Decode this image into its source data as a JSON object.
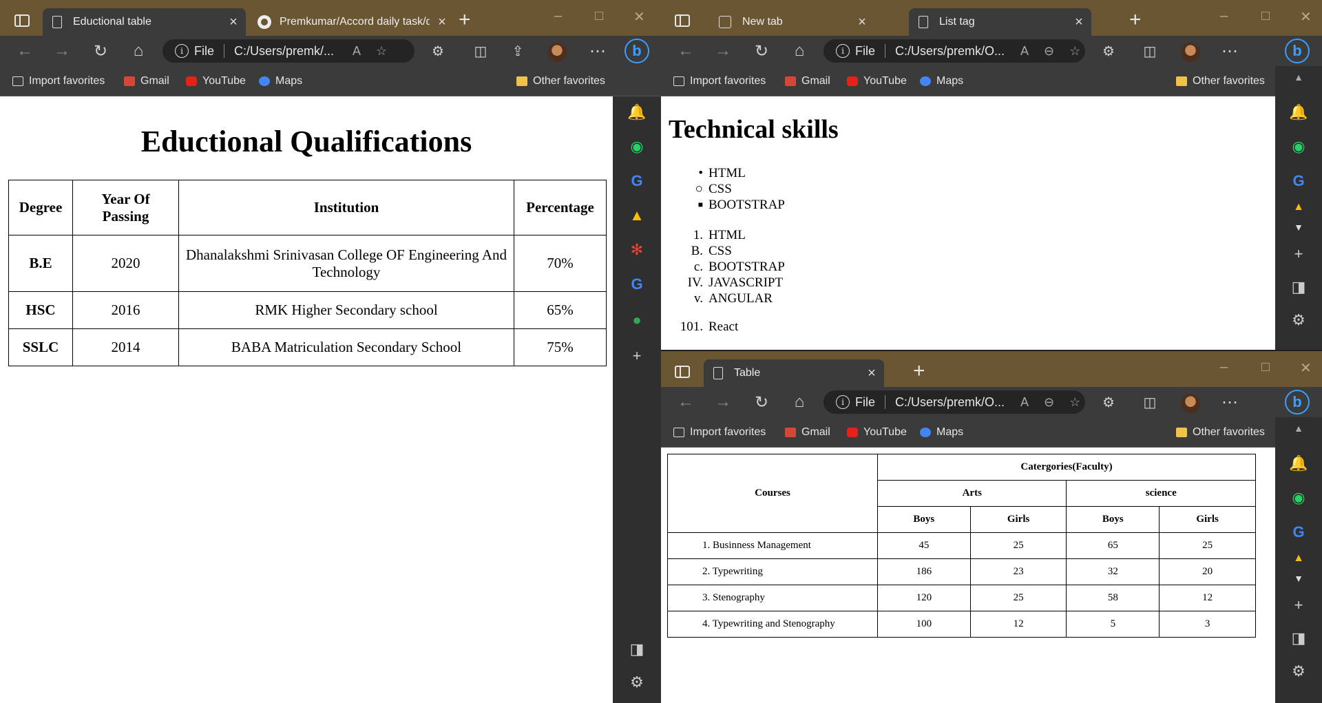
{
  "left_window": {
    "tabs": [
      {
        "label": "Eductional table",
        "active": true
      },
      {
        "label": "Premkumar/Accord daily task/da",
        "active": false
      }
    ],
    "address": {
      "scheme": "File",
      "url": "C:/Users/premk/..."
    },
    "page": {
      "heading": "Eductional Qualifications",
      "columns": [
        "Degree",
        "Year Of Passing",
        "Institution",
        "Percentage"
      ],
      "rows": [
        {
          "degree": "B.E",
          "year": "2020",
          "institution": "Dhanalakshmi Srinivasan College OF Engineering And Technology",
          "percentage": "70%"
        },
        {
          "degree": "HSC",
          "year": "2016",
          "institution": "RMK Higher Secondary school",
          "percentage": "65%"
        },
        {
          "degree": "SSLC",
          "year": "2014",
          "institution": "BABA Matriculation Secondary School",
          "percentage": "75%"
        }
      ]
    }
  },
  "top_right_window": {
    "tabs": [
      {
        "label": "New tab",
        "active": false
      },
      {
        "label": "List tag",
        "active": true
      }
    ],
    "address": {
      "scheme": "File",
      "url": "C:/Users/premk/O..."
    },
    "page": {
      "heading": "Technical skills",
      "unordered": [
        {
          "marker": "•",
          "text": "HTML"
        },
        {
          "marker": "○",
          "text": "CSS"
        },
        {
          "marker": "■",
          "text": "BOOTSTRAP"
        }
      ],
      "ordered": [
        {
          "marker": "1.",
          "text": "HTML"
        },
        {
          "marker": "B.",
          "text": "CSS"
        },
        {
          "marker": "c.",
          "text": "BOOTSTRAP"
        },
        {
          "marker": "IV.",
          "text": "JAVASCRIPT"
        },
        {
          "marker": "v.",
          "text": "ANGULAR"
        }
      ],
      "ordered2": [
        {
          "marker": "101.",
          "text": "React"
        }
      ]
    }
  },
  "bottom_right_window": {
    "tabs": [
      {
        "label": "Table",
        "active": true
      }
    ],
    "address": {
      "scheme": "File",
      "url": "C:/Users/premk/O..."
    },
    "page": {
      "courses_header": "Courses",
      "categories_header": "Catergories(Faculty)",
      "groups": [
        "Arts",
        "science"
      ],
      "subheaders": [
        "Boys",
        "Girls",
        "Boys",
        "Girls"
      ],
      "rows": [
        {
          "course": "1. Businness Management",
          "values": [
            "45",
            "25",
            "65",
            "25"
          ]
        },
        {
          "course": "2. Typewriting",
          "values": [
            "186",
            "23",
            "32",
            "20"
          ]
        },
        {
          "course": "3. Stenography",
          "values": [
            "120",
            "25",
            "58",
            "12"
          ]
        },
        {
          "course": "4. Typewriting and Stenography",
          "values": [
            "100",
            "12",
            "5",
            "3"
          ]
        }
      ]
    }
  },
  "favorites": {
    "import": "Import favorites",
    "gmail": "Gmail",
    "youtube": "YouTube",
    "maps": "Maps",
    "other": "Other favorites"
  },
  "colors": {
    "titlebar": "#6b5634",
    "toolbar": "#3b3b3b",
    "accent": "#3aa0ff"
  }
}
